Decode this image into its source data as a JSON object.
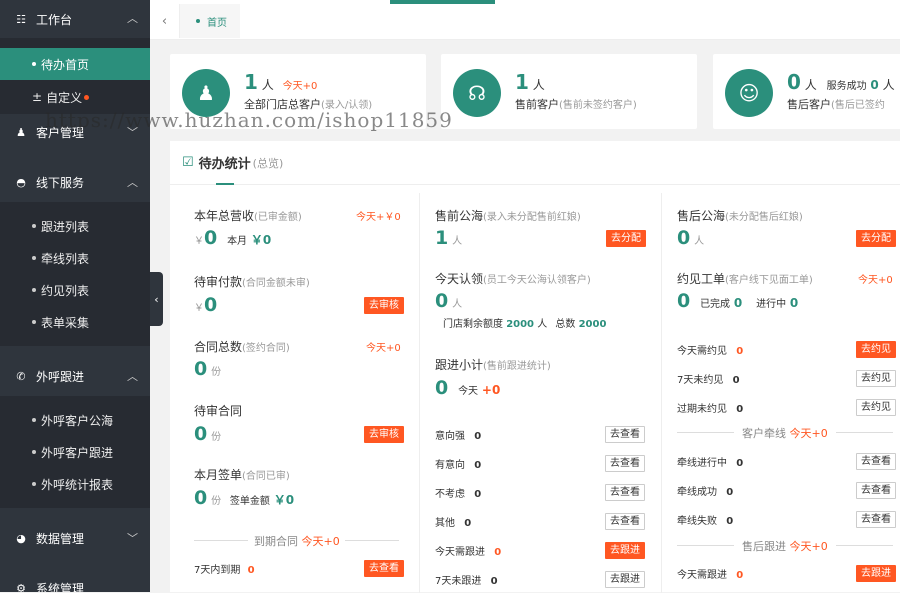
{
  "sidebar": {
    "workbench": "工作台",
    "home": "待办首页",
    "custom": "自定义",
    "customer": "客户管理",
    "offline": "线下服务",
    "followlist": "跟进列表",
    "leadlist": "牵线列表",
    "meetlist": "约见列表",
    "formcollect": "表单采集",
    "callfollow": "外呼跟进",
    "callpool": "外呼客户公海",
    "callcust": "外呼客户跟进",
    "callreport": "外呼统计报表",
    "datamgmt": "数据管理",
    "sysmgmt": "系统管理"
  },
  "tabs": {
    "home": "首页"
  },
  "watermark": "https://www.huzhan.com/ishop11859",
  "summary": [
    {
      "count": "1",
      "unit": "人",
      "extra": "今天+0",
      "title": "全部门店总客户",
      "sub": "(录入/认领)"
    },
    {
      "count": "1",
      "unit": "人",
      "extra": "",
      "title": "售前客户",
      "sub": "(售前未签约客户)"
    },
    {
      "count": "0",
      "unit": "人",
      "extra": "服务成功",
      "extra_num": "0",
      "extra_unit": "人",
      "title": "售后客户",
      "sub": "(售后已签约"
    }
  ],
  "panel": {
    "title": "待办统计",
    "sub": "(总览)"
  },
  "left": {
    "rev_title": "本年总营收",
    "rev_sub": "(已审金额)",
    "rev_today": "今天+￥0",
    "rev_cur": "￥",
    "rev_val": "0",
    "rev_month": "本月",
    "rev_month_val": "￥0",
    "pay_title": "待审付款",
    "pay_sub": "(合同金额未审)",
    "pay_cur": "￥",
    "pay_val": "0",
    "pay_btn": "去审核",
    "ct_title": "合同总数",
    "ct_sub": "(签约合同)",
    "ct_today": "今天+0",
    "ct_val": "0",
    "ct_unit": "份",
    "wait_title": "待审合同",
    "wait_val": "0",
    "wait_unit": "份",
    "wait_btn": "去审核",
    "sign_title": "本月签单",
    "sign_sub": "(合同已审)",
    "sign_val": "0",
    "sign_unit": "份",
    "sign_amt": "签单金额",
    "sign_amt_val": "￥0",
    "expire_title": "到期合同",
    "expire_today": "今天+0",
    "exp7": "7天内到期",
    "exp7_val": "0",
    "exp7_btn": "去查看"
  },
  "mid": {
    "pool_title": "售前公海",
    "pool_sub": "(录入未分配售前红娘)",
    "pool_val": "1",
    "pool_unit": "人",
    "pool_btn": "去分配",
    "claim_title": "今天认领",
    "claim_sub": "(员工今天公海认领客户)",
    "claim_val": "0",
    "claim_unit": "人",
    "quota_label": "门店剩余额度",
    "quota_val": "2000",
    "quota_unit": "人",
    "quota_total": "总数",
    "quota_total_val": "2000",
    "fs_title": "跟进小计",
    "fs_sub": "(售前跟进统计)",
    "fs_val": "0",
    "fs_today": "今天",
    "fs_today_val": "+0",
    "rows": [
      {
        "label": "意向强",
        "val": "0",
        "btn": "去查看"
      },
      {
        "label": "有意向",
        "val": "0",
        "btn": "去查看"
      },
      {
        "label": "不考虑",
        "val": "0",
        "btn": "去查看"
      },
      {
        "label": "其他",
        "val": "0",
        "btn": "去查看"
      },
      {
        "label": "今天需跟进",
        "val": "0",
        "btn": "去跟进"
      },
      {
        "label": "7天未跟进",
        "val": "0",
        "btn": "去跟进"
      }
    ]
  },
  "right": {
    "pool_title": "售后公海",
    "pool_sub": "(未分配售后红娘)",
    "pool_val": "0",
    "pool_unit": "人",
    "pool_btn": "去分配",
    "meet_title": "约见工单",
    "meet_sub": "(客户线下见面工单)",
    "meet_today": "今天+0",
    "meet_val": "0",
    "done": "已完成",
    "done_val": "0",
    "doing": "进行中",
    "doing_val": "0",
    "meet_rows": [
      {
        "label": "今天需约见",
        "val": "0",
        "btn": "去约见"
      },
      {
        "label": "7天未约见",
        "val": "0",
        "btn": "去约见"
      },
      {
        "label": "过期未约见",
        "val": "0",
        "btn": "去约见"
      }
    ],
    "lead_title": "客户牵线",
    "lead_today": "今天+0",
    "lead_rows": [
      {
        "label": "牵线进行中",
        "val": "0",
        "btn": "去查看"
      },
      {
        "label": "牵线成功",
        "val": "0",
        "btn": "去查看"
      },
      {
        "label": "牵线失败",
        "val": "0",
        "btn": "去查看"
      }
    ],
    "after_title": "售后跟进",
    "after_today": "今天+0",
    "after_row": {
      "label": "今天需跟进",
      "val": "0",
      "btn": "去跟进"
    }
  }
}
